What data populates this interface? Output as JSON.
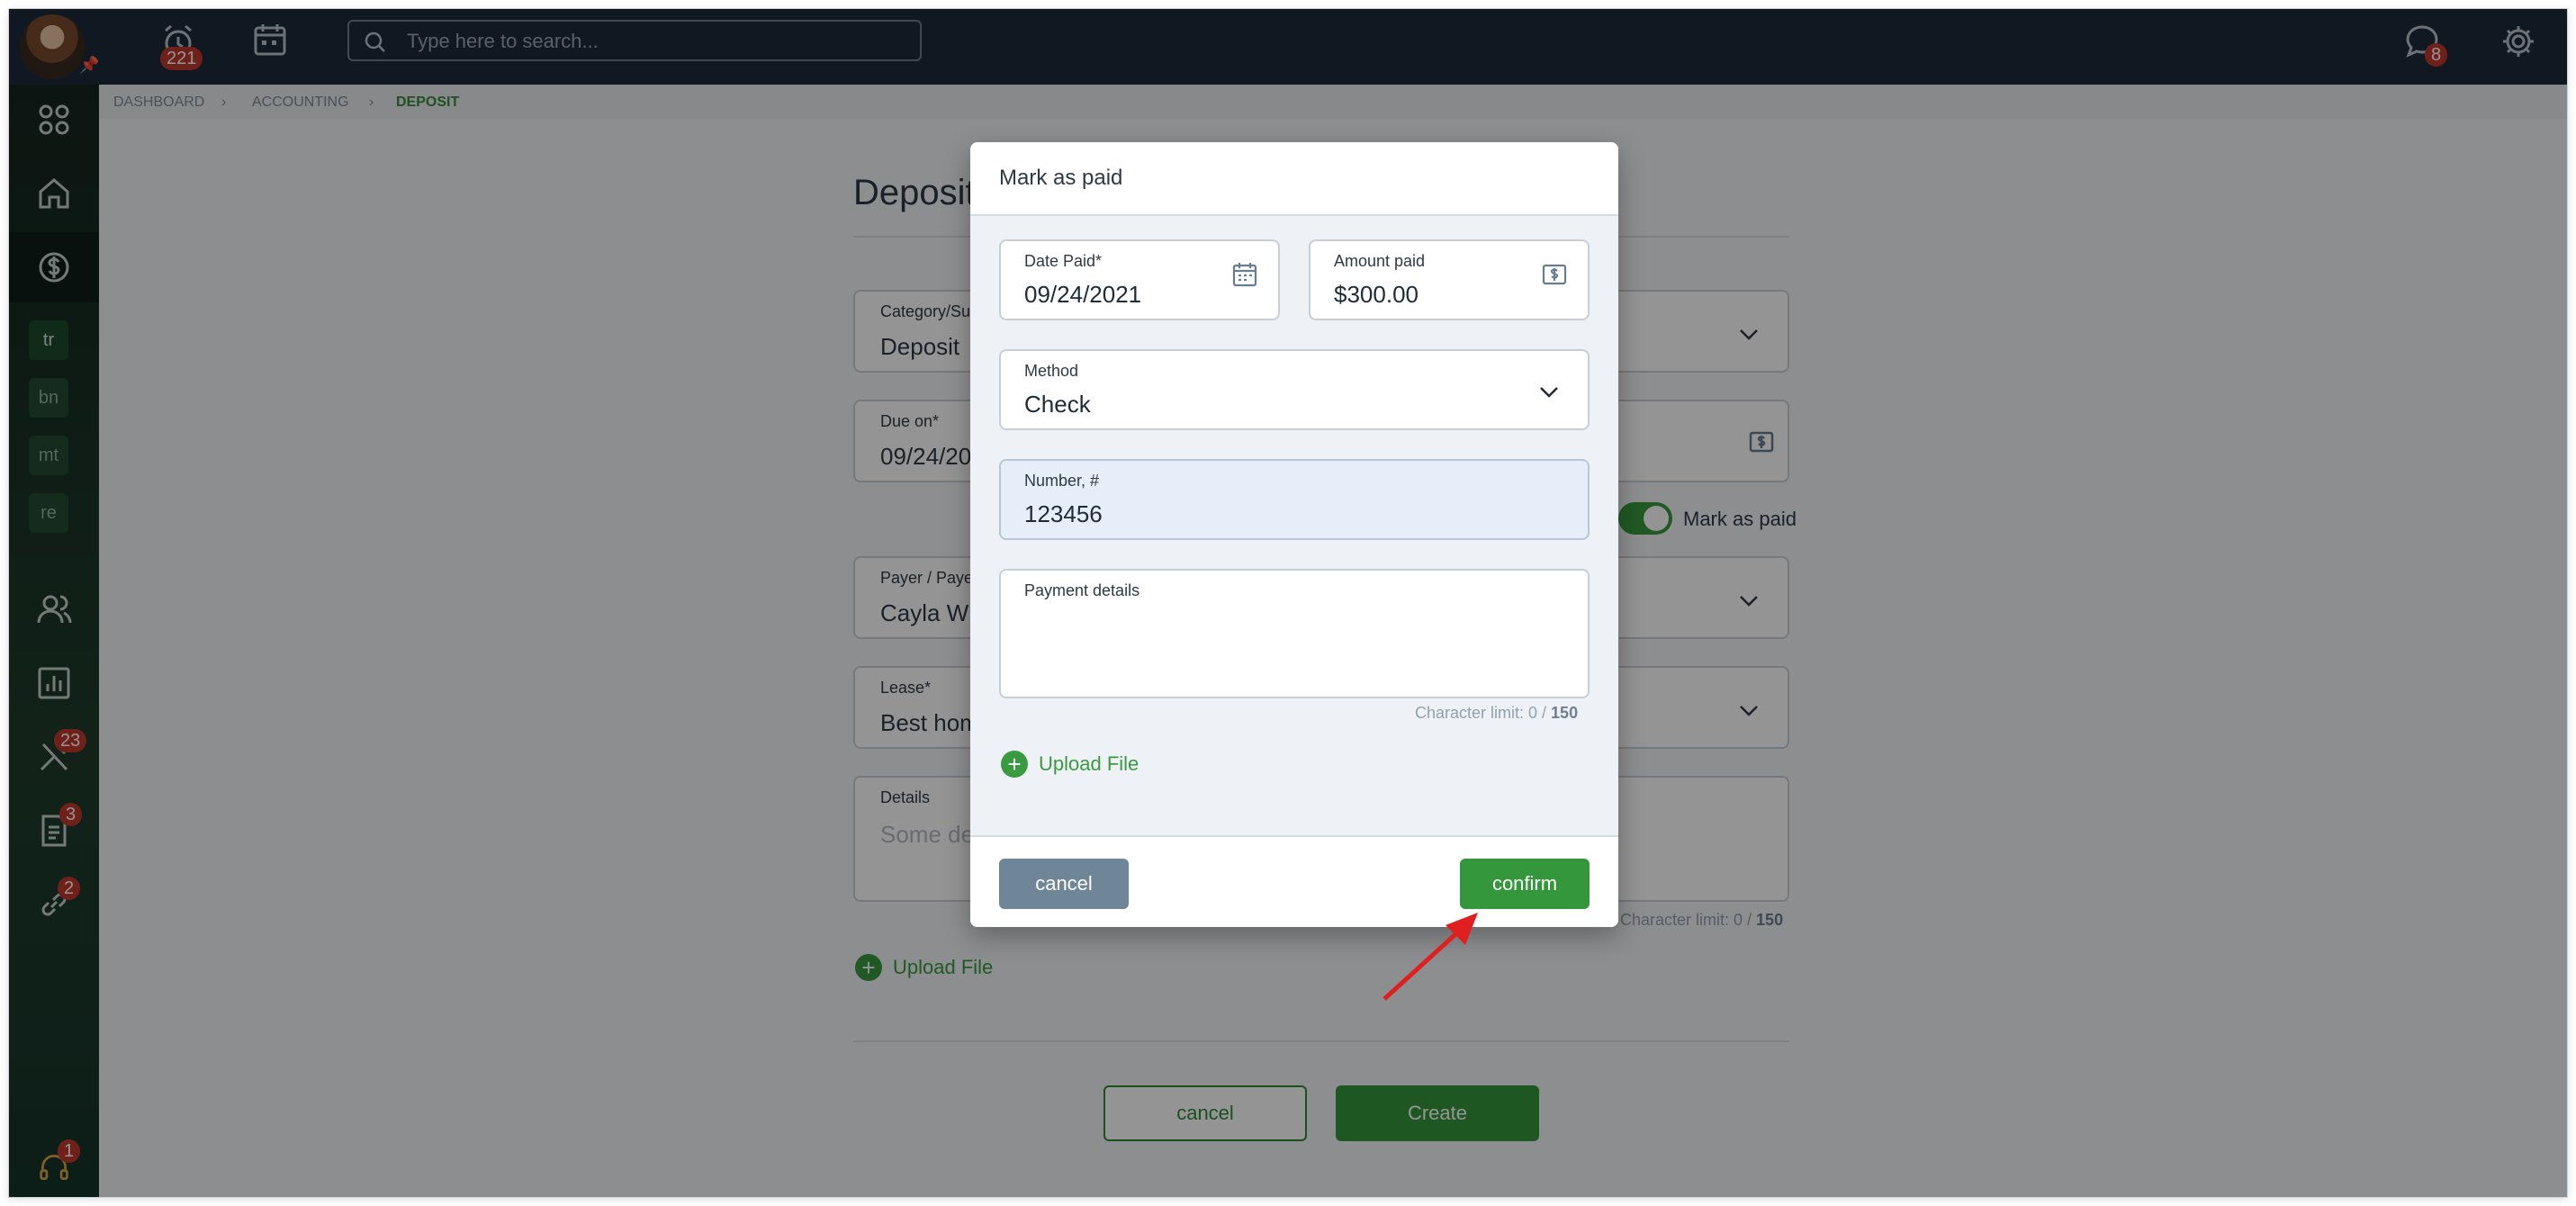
{
  "topbar": {
    "alarm_badge": "221",
    "search_placeholder": "Type here to search...",
    "chat_badge": "8"
  },
  "sidebar": {
    "text_items": [
      "tr",
      "bn",
      "mt",
      "re"
    ],
    "tools_badge": "23",
    "docs_badge": "3",
    "links_badge": "2",
    "support_badge": "1"
  },
  "breadcrumb": {
    "items": [
      "DASHBOARD",
      "ACCOUNTING",
      "DEPOSIT"
    ]
  },
  "page": {
    "title": "Deposit",
    "category_label": "Category/Su",
    "category_value": "Deposit",
    "due_label": "Due on*",
    "due_value": "09/24/20",
    "mark_paid_label": "Mark as paid",
    "payer_label": "Payer / Paye",
    "payer_value": "Cayla Wil",
    "lease_label": "Lease*",
    "lease_value": "Best hom",
    "details_label": "Details",
    "details_placeholder": "Some de",
    "char_limit_text": "Character limit: 0 / ",
    "char_limit_max": "150",
    "upload_label": "Upload File",
    "cancel_label": "cancel",
    "create_label": "Create"
  },
  "modal": {
    "title": "Mark as paid",
    "date_label": "Date Paid*",
    "date_value": "09/24/2021",
    "amount_label": "Amount paid",
    "amount_value": "$300.00",
    "method_label": "Method",
    "method_value": "Check",
    "number_label": "Number, #",
    "number_value": "123456",
    "details_label": "Payment details",
    "char_limit_text": "Character limit: 0 / ",
    "char_limit_max": "150",
    "upload_label": "Upload File",
    "cancel_label": "cancel",
    "confirm_label": "confirm"
  },
  "colors": {
    "primary_green": "#34973b",
    "topbar": "#1c2b3a",
    "badge_red": "#c0392b",
    "arrow_red": "#e02020"
  }
}
